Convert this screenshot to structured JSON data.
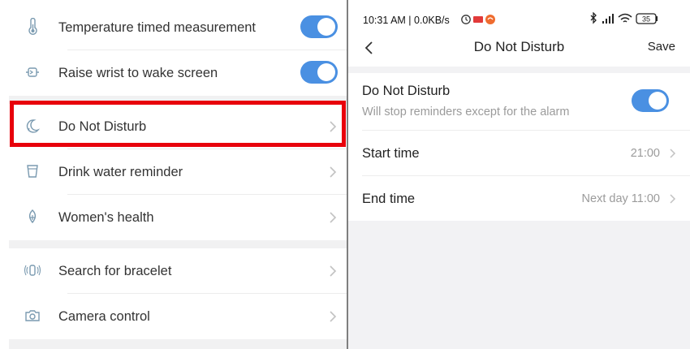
{
  "left_menu": {
    "items": [
      {
        "label": "Temperature timed measurement",
        "icon": "thermometer-icon",
        "toggle_on": true
      },
      {
        "label": "Raise wrist to wake screen",
        "icon": "wrist-icon",
        "toggle_on": true
      },
      {
        "label": "Do Not Disturb",
        "icon": "moon-icon"
      },
      {
        "label": "Drink water reminder",
        "icon": "cup-icon"
      },
      {
        "label": "Women's health",
        "icon": "flower-icon"
      },
      {
        "label": "Search for bracelet",
        "icon": "bracelet-signal-icon"
      },
      {
        "label": "Camera control",
        "icon": "camera-icon"
      }
    ]
  },
  "status_bar": {
    "time_text": "10:31 AM | 0.0KB/s",
    "battery": "35"
  },
  "nav": {
    "title": "Do Not Disturb",
    "save_label": "Save"
  },
  "dnd": {
    "title": "Do Not Disturb",
    "subtitle": "Will stop reminders except for the alarm",
    "enabled": true
  },
  "schedule": {
    "start_label": "Start time",
    "start_value": "21:00",
    "end_label": "End time",
    "end_value": "Next day 11:00"
  },
  "colors": {
    "accent": "#4a90e2",
    "highlight": "#e8000b",
    "icon": "#7a9ab0"
  }
}
